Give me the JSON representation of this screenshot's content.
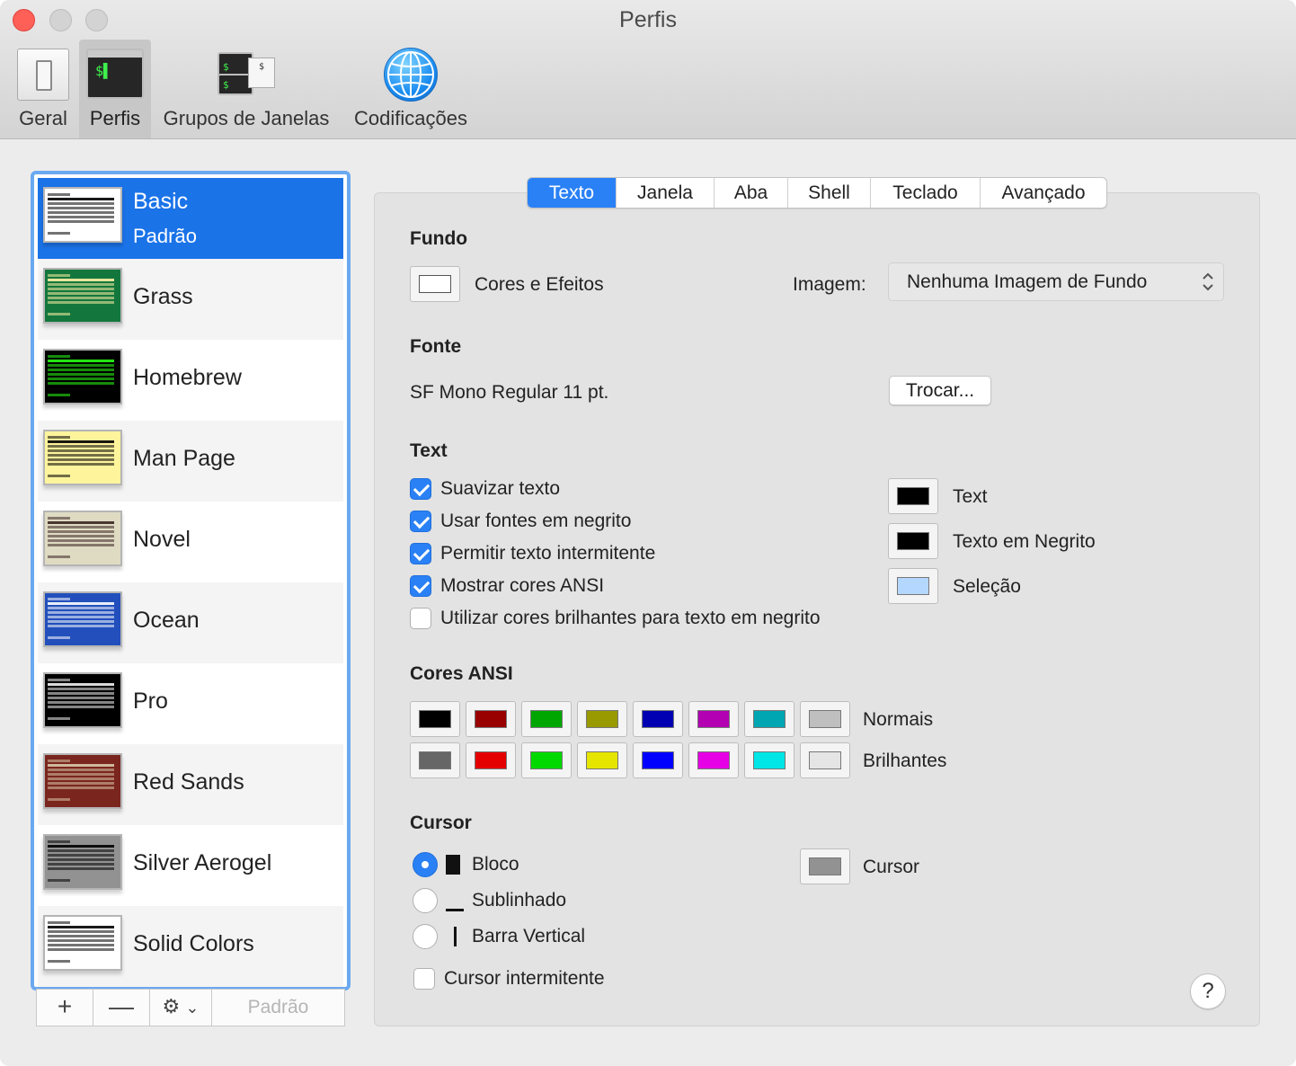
{
  "window": {
    "title": "Perfis"
  },
  "toolbar": {
    "items": [
      {
        "label": "Geral",
        "icon": "switch-icon"
      },
      {
        "label": "Perfis",
        "icon": "terminal-icon",
        "active": true
      },
      {
        "label": "Grupos de Janelas",
        "icon": "window-groups-icon"
      },
      {
        "label": "Codificações",
        "icon": "globe-icon"
      }
    ],
    "terminal_prompt": "$",
    "prompt_glyph": "$▌"
  },
  "sidebar": {
    "profiles": [
      {
        "name": "Basic",
        "subtitle": "Padrão",
        "selected": true,
        "bg": "#ffffff",
        "fg": "#000000"
      },
      {
        "name": "Grass",
        "bg": "#13773d",
        "fg": "#fff0a5"
      },
      {
        "name": "Homebrew",
        "bg": "#000000",
        "fg": "#28fe14"
      },
      {
        "name": "Man Page",
        "bg": "#fef49c",
        "fg": "#000000"
      },
      {
        "name": "Novel",
        "bg": "#dfdbc3",
        "fg": "#3b2322"
      },
      {
        "name": "Ocean",
        "bg": "#224fbc",
        "fg": "#ffffff"
      },
      {
        "name": "Pro",
        "bg": "#000000",
        "fg": "#f2f2f2"
      },
      {
        "name": "Red Sands",
        "bg": "#7a251e",
        "fg": "#d7c9a7"
      },
      {
        "name": "Silver Aerogel",
        "bg": "#929292",
        "fg": "#000000"
      },
      {
        "name": "Solid Colors",
        "bg": "#ffffff",
        "fg": "#000000"
      }
    ],
    "buttons": {
      "add": "+",
      "remove": "—",
      "gear": "⚙",
      "chevron": "⌄",
      "default": "Padrão"
    }
  },
  "tabs": [
    "Texto",
    "Janela",
    "Aba",
    "Shell",
    "Teclado",
    "Avançado"
  ],
  "fundo": {
    "title": "Fundo",
    "colors_label": "Cores e Efeitos",
    "image_label": "Imagem:",
    "image_value": "Nenhuma Imagem de Fundo",
    "popup_arrow": "⌃⌄"
  },
  "fonte": {
    "title": "Fonte",
    "value": "SF Mono Regular 11 pt.",
    "change_button": "Trocar..."
  },
  "text": {
    "title": "Text",
    "options": [
      {
        "label": "Suavizar texto",
        "checked": true
      },
      {
        "label": "Usar fontes em negrito",
        "checked": true
      },
      {
        "label": "Permitir texto intermitente",
        "checked": true
      },
      {
        "label": "Mostrar cores ANSI",
        "checked": true
      },
      {
        "label": "Utilizar cores brilhantes para texto em negrito",
        "checked": false
      }
    ],
    "colors": [
      {
        "label": "Text",
        "color": "#000000"
      },
      {
        "label": "Texto em Negrito",
        "color": "#000000"
      },
      {
        "label": "Seleção",
        "color": "#b3d7ff"
      }
    ]
  },
  "ansi": {
    "title": "Cores ANSI",
    "normal_label": "Normais",
    "bright_label": "Brilhantes",
    "normal": [
      "#000000",
      "#990000",
      "#00a600",
      "#999900",
      "#0000b2",
      "#b200b2",
      "#00a6b2",
      "#bfbfbf"
    ],
    "bright": [
      "#666666",
      "#e50000",
      "#00d900",
      "#e5e500",
      "#0000ff",
      "#e500e5",
      "#00e5e5",
      "#e5e5e5"
    ]
  },
  "cursor": {
    "title": "Cursor",
    "styles": [
      {
        "label": "Bloco",
        "selected": true
      },
      {
        "label": "Sublinhado",
        "selected": false
      },
      {
        "label": "Barra Vertical",
        "selected": false
      }
    ],
    "blink_label": "Cursor intermitente",
    "blink": false,
    "color_label": "Cursor",
    "color": "#929292"
  },
  "help": "?"
}
